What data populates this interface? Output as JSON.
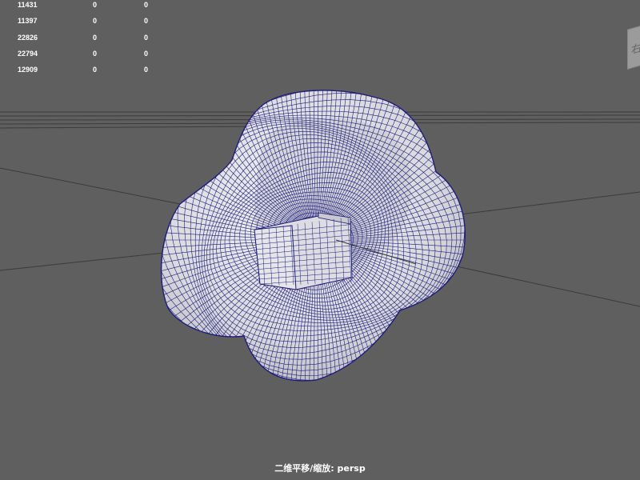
{
  "hud": {
    "rows": [
      [
        "11431",
        "0",
        "0"
      ],
      [
        "22826",
        "0",
        "0"
      ],
      [
        "11397",
        "0",
        "0"
      ],
      [
        "22794",
        "0",
        "0"
      ],
      [
        "12909",
        "0",
        "0"
      ]
    ]
  },
  "camera_label": "二维平移/缩放: persp",
  "viewcube": {
    "face_label": "右"
  },
  "colors": {
    "background": "#5f5f5f",
    "wireframe": "#1d1d7a",
    "surface": "#e8e8ec",
    "grid": "#3a3a3a"
  }
}
